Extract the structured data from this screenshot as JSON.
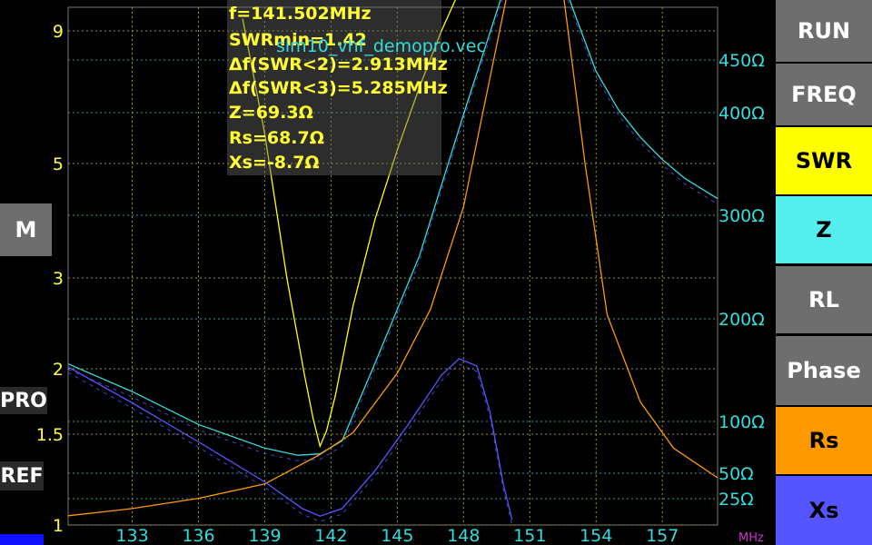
{
  "file_name": "sim10_vhf_demopro.vec",
  "info": {
    "f": "f=141.502MHz",
    "swr_min": "SWRmin=1.42",
    "df_swr2": "Δf(SWR<2)=2.913MHz",
    "df_swr3": "Δf(SWR<3)=5.285MHz",
    "z": "Z=69.3Ω",
    "rs": "Rs=68.7Ω",
    "xs": "Xs=-8.7Ω"
  },
  "buttons": {
    "run": "RUN",
    "freq": "FREQ",
    "swr": "SWR",
    "z": "Z",
    "rl": "RL",
    "phase": "Phase",
    "rs": "Rs",
    "xs": "Xs"
  },
  "side": {
    "m": "M",
    "pro": "PRO",
    "ref": "REF"
  },
  "colors": {
    "swr": "#ffff00",
    "z": "#33dddd",
    "rs": "#ff9900",
    "xs": "#5555ff",
    "run_bg": "#6e6e6e",
    "freq_bg": "#6e6e6e",
    "rl_bg": "#6e6e6e",
    "phase_bg": "#6e6e6e",
    "swr_bg": "#ffff00",
    "z_bg": "#55eeee",
    "rs_bg": "#ff9900",
    "xs_bg": "#5555ff",
    "grid": "#999933",
    "unit": "#cc33cc"
  },
  "chart_data": {
    "type": "line",
    "x_unit": "MHz",
    "x_ticks": [
      133,
      136,
      139,
      142,
      145,
      148,
      151,
      154,
      157
    ],
    "xlim": [
      130.1,
      159.5
    ],
    "left_axis": {
      "scale": "swr",
      "ticks": [
        "9",
        "5",
        "3",
        "2",
        "1.5",
        "1"
      ]
    },
    "right_axis": {
      "ticks": [
        "450Ω",
        "400Ω",
        "300Ω",
        "200Ω",
        "100Ω",
        "50Ω",
        "25Ω"
      ]
    },
    "series": [
      {
        "name": "SWR",
        "axis": "left",
        "x": [
          138.0,
          139.0,
          140.0,
          140.8,
          141.2,
          141.502,
          141.8,
          142.2,
          143.0,
          144.0,
          145.0,
          146.0,
          147.0,
          148.0,
          149.0,
          149.6
        ],
        "y": [
          9.5,
          5.7,
          3.0,
          1.95,
          1.6,
          1.42,
          1.52,
          1.78,
          2.65,
          3.9,
          5.3,
          7.0,
          9.0,
          11.2,
          13.5,
          15.0
        ]
      },
      {
        "name": "Z",
        "axis": "right",
        "x": [
          130.1,
          133,
          136,
          139,
          140.5,
          141.5,
          142.5,
          144,
          146,
          148,
          149.5,
          150.4,
          152,
          153,
          154,
          155,
          156,
          157,
          158,
          159.5
        ],
        "y": [
          157,
          130,
          98,
          75,
          68,
          69.3,
          82,
          158,
          262,
          400,
          500,
          560,
          560,
          500,
          442,
          405,
          378,
          356,
          338,
          318
        ]
      },
      {
        "name": "Rs",
        "axis": "right",
        "x": [
          130.1,
          133,
          136,
          139,
          141.5,
          143,
          145,
          146.5,
          148,
          149,
          150,
          151,
          152,
          152.5,
          153.5,
          154.5,
          156,
          157.5,
          159.5
        ],
        "y": [
          9,
          16,
          26,
          40,
          68.7,
          90,
          148,
          210,
          310,
          415,
          520,
          620,
          620,
          520,
          352,
          205,
          120,
          75,
          46
        ]
      },
      {
        "name": "Xs",
        "axis": "right",
        "x": [
          130.1,
          133,
          136,
          139,
          140.7,
          141.502,
          142.5,
          144,
          145.5,
          147,
          147.8,
          148.6,
          149.2,
          149.8,
          150.2
        ],
        "y": [
          154,
          119,
          81,
          42,
          16,
          -8.7,
          16,
          53,
          98,
          146,
          162,
          155,
          110,
          40,
          -5
        ]
      }
    ]
  }
}
